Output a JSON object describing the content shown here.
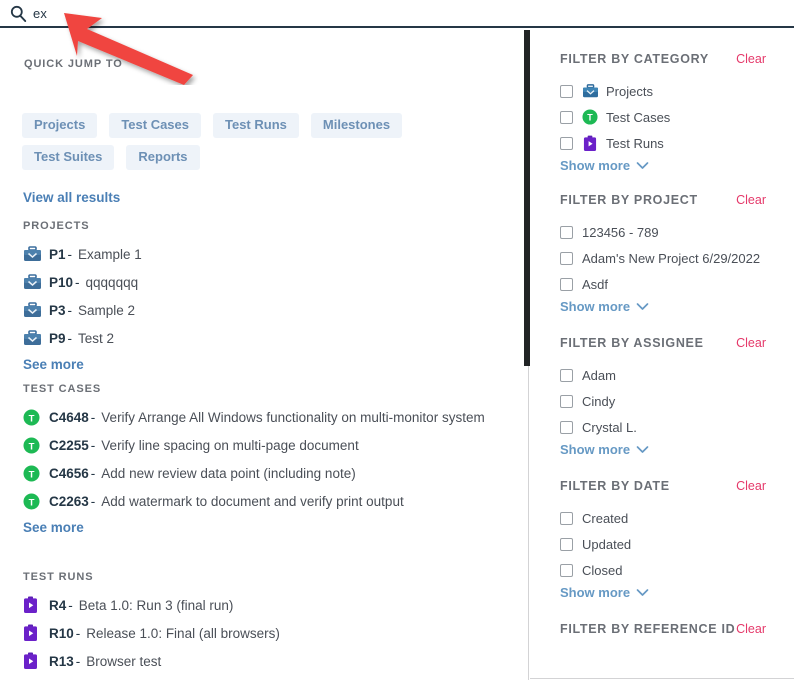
{
  "search": {
    "icon": "search-icon",
    "value": "ex",
    "placeholder": "Search"
  },
  "results": {
    "quick_jump_label": "QUICK JUMP TO",
    "quick_jump_chips": [
      "Projects",
      "Test Cases",
      "Test Runs",
      "Milestones",
      "Test Suites",
      "Reports"
    ],
    "view_all_results": "View all results",
    "groups": [
      {
        "label": "PROJECTS",
        "icon": "briefcase-icon",
        "items": [
          {
            "id": "P1",
            "dash": "-",
            "title": "Example 1"
          },
          {
            "id": "P10",
            "dash": "-",
            "title": "qqqqqqq"
          },
          {
            "id": "P3",
            "dash": "-",
            "title": "Sample 2"
          },
          {
            "id": "P9",
            "dash": "-",
            "title": "Test 2"
          }
        ],
        "see_more": "See more"
      },
      {
        "label": "TEST CASES",
        "icon": "test-case-icon",
        "items": [
          {
            "id": "C4648",
            "dash": "-",
            "title": "Verify Arrange All Windows functionality on multi-monitor system"
          },
          {
            "id": "C2255",
            "dash": "-",
            "title": "Verify line spacing on multi-page document"
          },
          {
            "id": "C4656",
            "dash": "-",
            "title": "Add new review data point (including note)"
          },
          {
            "id": "C2263",
            "dash": "-",
            "title": "Add watermark to document and verify print output"
          }
        ],
        "see_more": "See more"
      },
      {
        "label": "TEST RUNS",
        "icon": "test-run-icon",
        "items": [
          {
            "id": "R4",
            "dash": "-",
            "title": "Beta 1.0: Run 3 (final run)"
          },
          {
            "id": "R10",
            "dash": "-",
            "title": "Release 1.0: Final (all browsers)"
          },
          {
            "id": "R13",
            "dash": "-",
            "title": "Browser test"
          }
        ],
        "see_more": ""
      }
    ]
  },
  "filters": {
    "clear_label": "Clear",
    "show_more_label": "Show more",
    "sections": [
      {
        "title": "FILTER BY CATEGORY",
        "clear": "Clear",
        "options": [
          {
            "label": "Projects",
            "icon": "briefcase-icon",
            "checked": false
          },
          {
            "label": "Test Cases",
            "icon": "test-case-icon",
            "checked": false
          },
          {
            "label": "Test Runs",
            "icon": "test-run-icon",
            "checked": false
          }
        ],
        "show_more": "Show more"
      },
      {
        "title": "FILTER BY PROJECT",
        "clear": "Clear",
        "options": [
          {
            "label": "123456 - 789",
            "icon": "",
            "checked": false
          },
          {
            "label": "Adam's New Project 6/29/2022",
            "icon": "",
            "checked": false
          },
          {
            "label": "Asdf",
            "icon": "",
            "checked": false
          }
        ],
        "show_more": "Show more"
      },
      {
        "title": "FILTER BY ASSIGNEE",
        "clear": "Clear",
        "options": [
          {
            "label": "Adam",
            "icon": "",
            "checked": false
          },
          {
            "label": "Cindy",
            "icon": "",
            "checked": false
          },
          {
            "label": "Crystal L.",
            "icon": "",
            "checked": false
          }
        ],
        "show_more": "Show more"
      },
      {
        "title": "FILTER BY DATE",
        "clear": "Clear",
        "options": [
          {
            "label": "Created",
            "icon": "",
            "checked": false
          },
          {
            "label": "Updated",
            "icon": "",
            "checked": false
          },
          {
            "label": "Closed",
            "icon": "",
            "checked": false
          }
        ],
        "show_more": "Show more"
      },
      {
        "title": "FILTER BY REFERENCE ID",
        "clear": "Clear",
        "options": [],
        "show_more": ""
      }
    ]
  },
  "annotation": {
    "arrow": "red-arrow-pointer"
  },
  "colors": {
    "accent_blue": "#4a7fb5",
    "chip_bg": "#eef3f9",
    "chip_text": "#6d90b5",
    "clear_pink": "#e5396a",
    "project_icon": "#2e6da4",
    "test_case_icon": "#22b14c",
    "test_run_icon": "#6b21c9",
    "header_rule": "#253746",
    "arrow_red": "#f0453f"
  }
}
